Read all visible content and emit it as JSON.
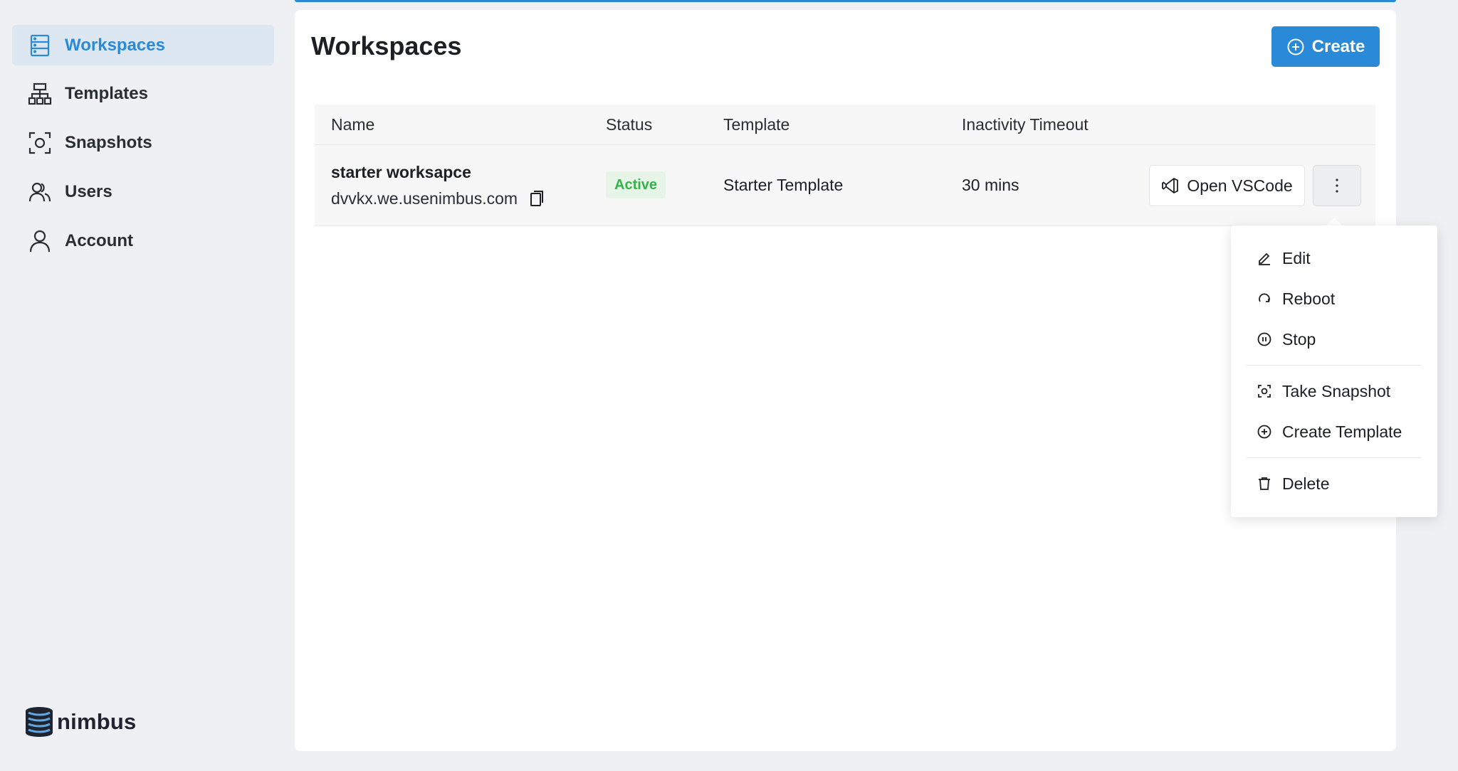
{
  "sidebar": {
    "items": [
      {
        "label": "Workspaces",
        "icon": "server-icon",
        "active": true
      },
      {
        "label": "Templates",
        "icon": "sitemap-icon",
        "active": false
      },
      {
        "label": "Snapshots",
        "icon": "camera-scan-icon",
        "active": false
      },
      {
        "label": "Users",
        "icon": "users-icon",
        "active": false
      },
      {
        "label": "Account",
        "icon": "user-icon",
        "active": false
      }
    ],
    "brand": "nimbus"
  },
  "main": {
    "title": "Workspaces",
    "create_label": "Create",
    "table": {
      "headers": [
        "Name",
        "Status",
        "Template",
        "Inactivity Timeout"
      ],
      "rows": [
        {
          "name": "starter worksapce",
          "host": "dvvkx.we.usenimbus.com",
          "status": "Active",
          "template": "Starter Template",
          "timeout": "30 mins",
          "open_label": "Open VSCode"
        }
      ]
    }
  },
  "menu": {
    "items": [
      "Edit",
      "Reboot",
      "Stop",
      "Take Snapshot",
      "Create Template",
      "Delete"
    ]
  },
  "colors": {
    "accent": "#2a8ad8",
    "active_badge_bg": "#e6f5e8",
    "active_badge_text": "#35b24a"
  }
}
